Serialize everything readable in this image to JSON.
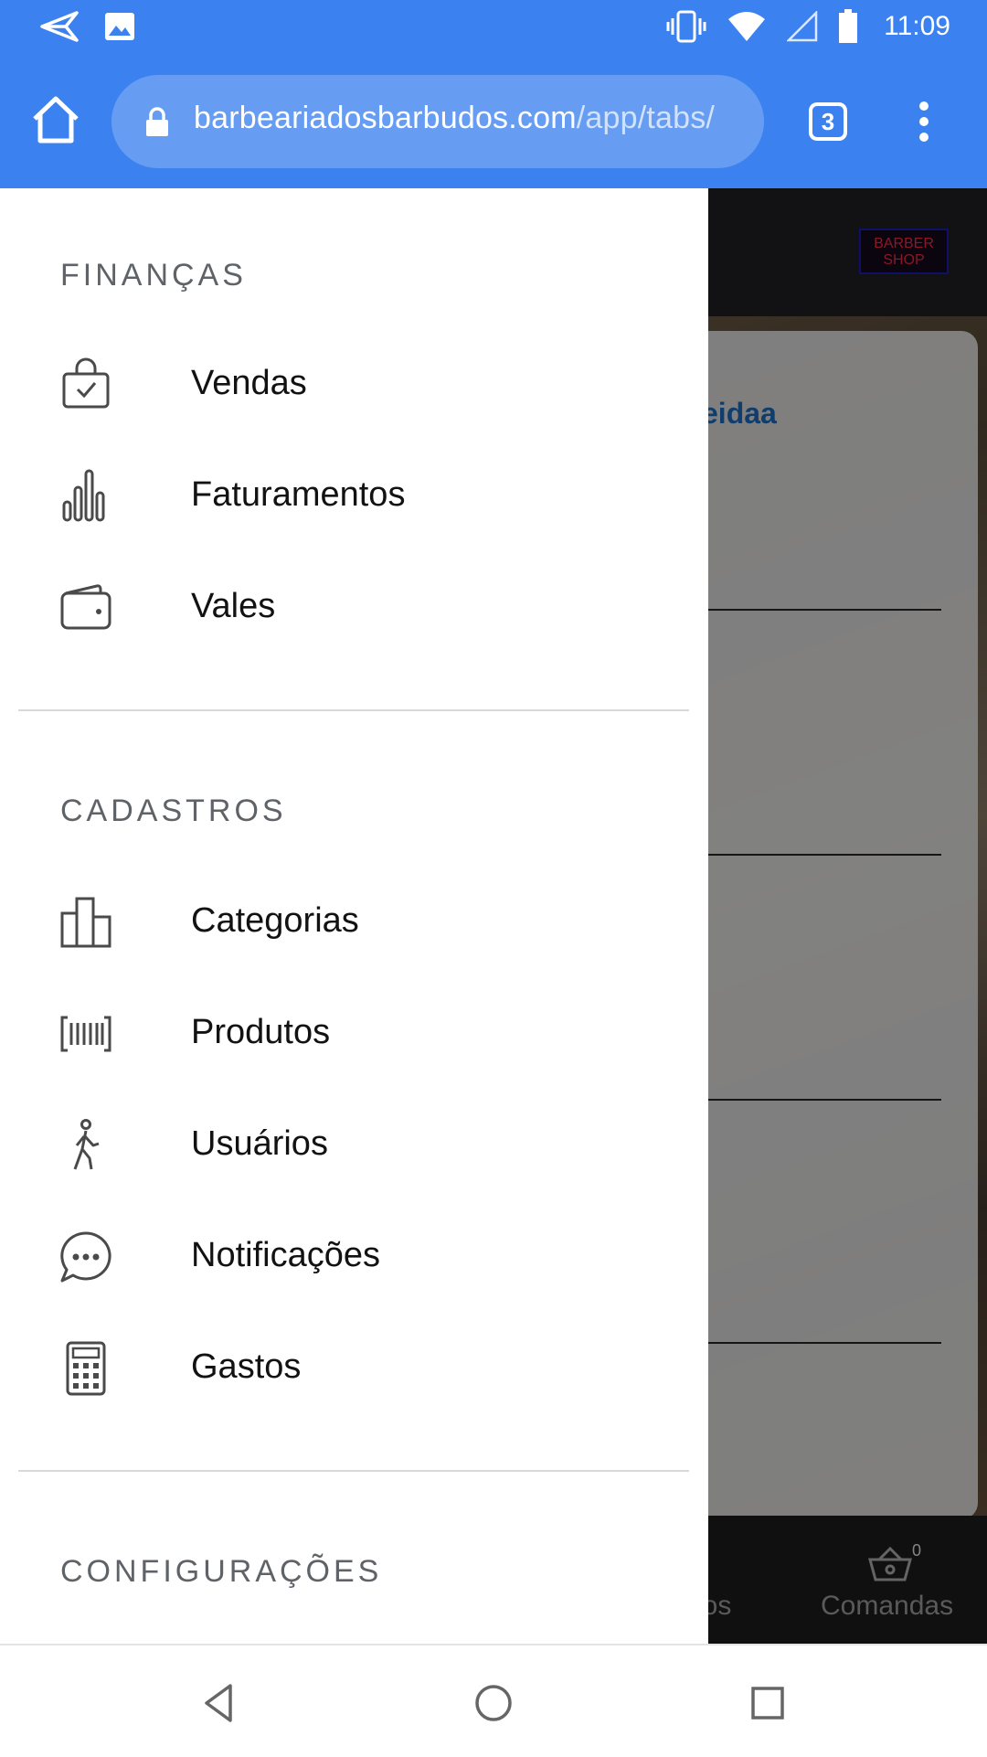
{
  "status_bar": {
    "time": "11:09",
    "icons": [
      "send-notification-icon",
      "image-notification-icon",
      "vibrate-icon",
      "wifi-icon",
      "signal-icon",
      "battery-icon"
    ]
  },
  "browser": {
    "url_domain": "barbeariadosbarbudos.com",
    "url_path": "/app/tabs/",
    "tab_count": "3",
    "chrome_color": "#3b82f0"
  },
  "background_app": {
    "logo_text_line1": "BARBER",
    "logo_text_line2": "SHOP",
    "partial_name": "eidaa",
    "tabs": [
      {
        "label": "rios",
        "icon": "box-icon"
      },
      {
        "label": "Comandas",
        "icon": "basket-icon",
        "badge": "0"
      }
    ]
  },
  "drawer": {
    "sections": [
      {
        "title": "FINANÇAS",
        "items": [
          {
            "label": "Vendas",
            "icon": "shopping-bag-check-icon"
          },
          {
            "label": "Faturamentos",
            "icon": "bar-chart-icon"
          },
          {
            "label": "Vales",
            "icon": "wallet-icon"
          }
        ]
      },
      {
        "title": "CADASTROS",
        "items": [
          {
            "label": "Categorias",
            "icon": "buildings-icon"
          },
          {
            "label": "Produtos",
            "icon": "barcode-icon"
          },
          {
            "label": "Usuários",
            "icon": "walking-person-icon"
          },
          {
            "label": "Notificações",
            "icon": "chat-bubble-icon"
          },
          {
            "label": "Gastos",
            "icon": "calculator-icon"
          }
        ]
      },
      {
        "title": "CONFIGURAÇÕES",
        "items": []
      }
    ]
  },
  "nav_bar": {
    "buttons": [
      "back-icon",
      "home-circle-icon",
      "recents-icon"
    ]
  }
}
